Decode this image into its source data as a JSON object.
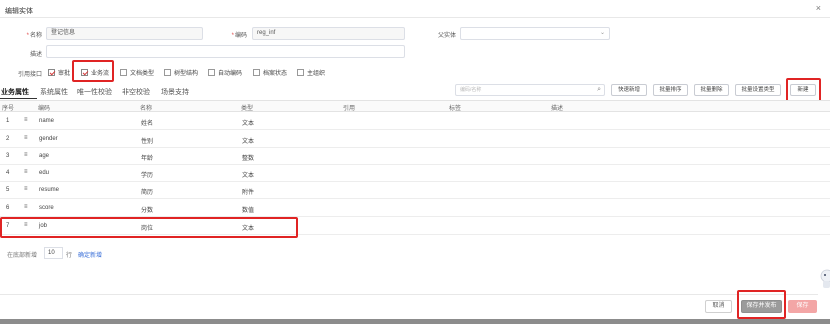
{
  "dialog": {
    "title": "编辑实体"
  },
  "form": {
    "name_label": "名称",
    "name_value": "登记信息",
    "code_label": "编码",
    "code_value": "reg_inf",
    "parent_label": "父实体",
    "desc_label": "描述",
    "ref_label": "引用接口",
    "checks": [
      {
        "label": "审批",
        "checked": true
      },
      {
        "label": "业务流",
        "checked": true
      },
      {
        "label": "文档类型",
        "checked": false
      },
      {
        "label": "树型结构",
        "checked": false
      },
      {
        "label": "自动编码",
        "checked": false
      },
      {
        "label": "档案状态",
        "checked": false
      },
      {
        "label": "主组织",
        "checked": false
      }
    ]
  },
  "tabs": [
    "业务属性",
    "系统属性",
    "唯一性校验",
    "非空校验",
    "场景支持"
  ],
  "toolbar": {
    "search_placeholder": "编码/名称",
    "quick_add": "快速新增",
    "batch_sort": "批量排序",
    "batch_delete": "批量删除",
    "batch_set_type": "批量设置类型",
    "new": "新建"
  },
  "table": {
    "headers": [
      "序号",
      "编码",
      "名称",
      "类型",
      "引用",
      "标签",
      "描述"
    ],
    "rows": [
      {
        "no": "1",
        "code": "name",
        "name": "姓名",
        "type": "文本"
      },
      {
        "no": "2",
        "code": "gender",
        "name": "性别",
        "type": "文本"
      },
      {
        "no": "3",
        "code": "age",
        "name": "年龄",
        "type": "整数"
      },
      {
        "no": "4",
        "code": "edu",
        "name": "学历",
        "type": "文本"
      },
      {
        "no": "5",
        "code": "resume",
        "name": "简历",
        "type": "附件"
      },
      {
        "no": "6",
        "code": "score",
        "name": "分数",
        "type": "数值"
      },
      {
        "no": "7",
        "code": "job",
        "name": "岗位",
        "type": "文本"
      }
    ]
  },
  "pager": {
    "prefix": "在底部新增",
    "count": "10",
    "suffix": "行",
    "confirm": "确定新增"
  },
  "footer": {
    "cancel": "取消",
    "save_publish": "保存并发布",
    "save": "保存"
  },
  "icons": {
    "close": "close-icon",
    "search": "search-icon",
    "drag": "drag-handle-icon",
    "caret": "chevron-down-icon"
  },
  "colors": {
    "highlight": "#e02424",
    "primary_disabled": "#f3a6a6",
    "publish_btn": "#9b9b9b",
    "link": "#3a6fd8"
  }
}
